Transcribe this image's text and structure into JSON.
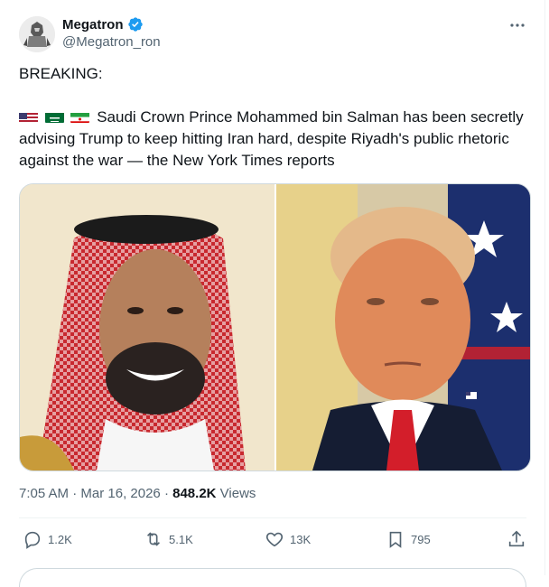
{
  "author": {
    "display_name": "Megatron",
    "handle": "@Megatron_ron",
    "verified": true
  },
  "post": {
    "line1": "BREAKING:",
    "flags": [
      "us-flag-icon",
      "saudi-flag-icon",
      "iran-flag-icon"
    ],
    "line2": "Saudi Crown Prince Mohammed bin Salman has been secretly advising Trump to keep hitting Iran hard, despite Riyadh's public rhetoric against the war — the New York Times reports"
  },
  "media": {
    "left_photo": "photo-crown-prince",
    "right_photo": "photo-trump"
  },
  "meta": {
    "time": "7:05 AM",
    "sep1": " · ",
    "date": "Mar 16, 2026",
    "sep2": " · ",
    "views_count": "848.2K",
    "views_label": " Views"
  },
  "actions": {
    "replies": "1.2K",
    "reposts": "5.1K",
    "likes": "13K",
    "bookmarks": "795"
  },
  "colors": {
    "text": "#0f1419",
    "secondary": "#536471",
    "verified_blue": "#1d9bf0",
    "border": "#cfd9de"
  }
}
